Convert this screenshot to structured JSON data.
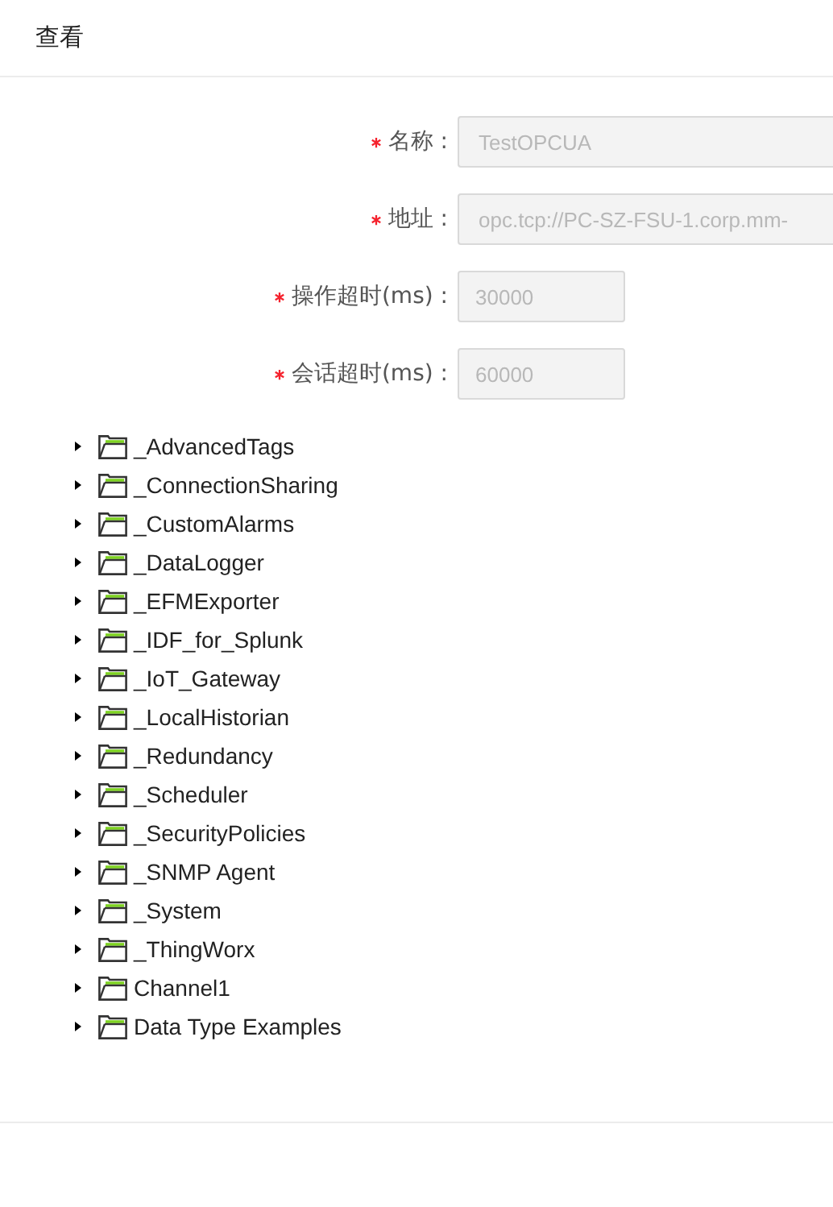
{
  "header": {
    "title": "查看"
  },
  "form": [
    {
      "label": "名称 :",
      "required": true,
      "value": "TestOPCUA",
      "kind": "wide"
    },
    {
      "label": "地址 :",
      "required": true,
      "value": "opc.tcp://PC-SZ-FSU-1.corp.mm-",
      "kind": "wide"
    },
    {
      "label": "操作超时(ms) :",
      "required": true,
      "value": "30000",
      "kind": "short"
    },
    {
      "label": "会话超时(ms) :",
      "required": true,
      "value": "60000",
      "kind": "short"
    }
  ],
  "tree": [
    {
      "label": "_AdvancedTags",
      "expanded": false
    },
    {
      "label": "_ConnectionSharing",
      "expanded": false
    },
    {
      "label": "_CustomAlarms",
      "expanded": false
    },
    {
      "label": "_DataLogger",
      "expanded": false
    },
    {
      "label": "_EFMExporter",
      "expanded": false
    },
    {
      "label": "_IDF_for_Splunk",
      "expanded": false
    },
    {
      "label": "_IoT_Gateway",
      "expanded": false
    },
    {
      "label": "_LocalHistorian",
      "expanded": false
    },
    {
      "label": "_Redundancy",
      "expanded": false
    },
    {
      "label": "_Scheduler",
      "expanded": false
    },
    {
      "label": "_SecurityPolicies",
      "expanded": false
    },
    {
      "label": "_SNMP Agent",
      "expanded": false
    },
    {
      "label": "_System",
      "expanded": false
    },
    {
      "label": "_ThingWorx",
      "expanded": false
    },
    {
      "label": "Channel1",
      "expanded": false
    },
    {
      "label": "Data Type Examples",
      "expanded": false
    }
  ]
}
